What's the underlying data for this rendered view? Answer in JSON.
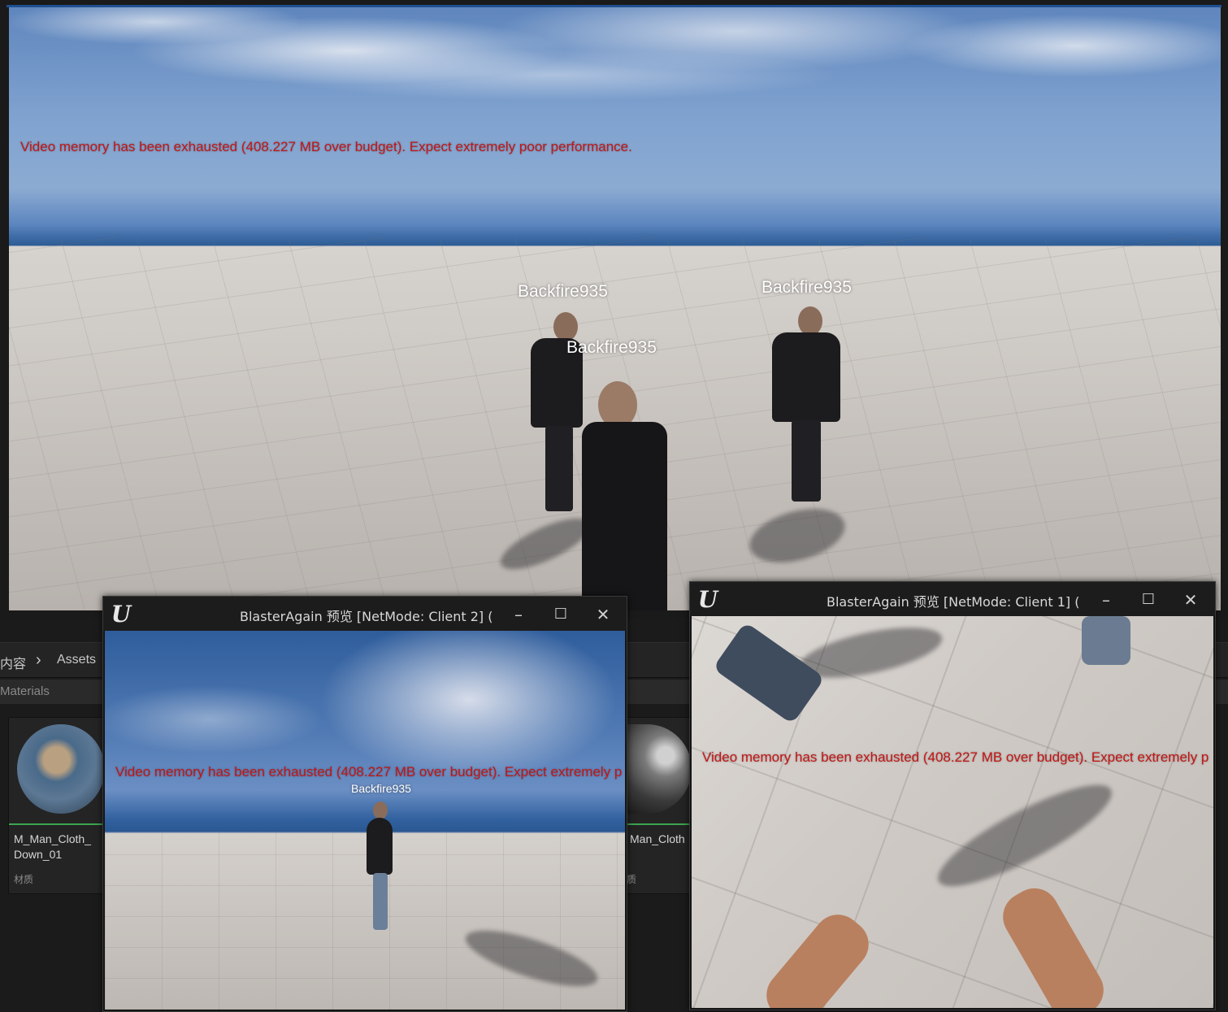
{
  "main_viewport": {
    "warning": "Video memory has been exhausted (408.227 MB over budget). Expect extremely poor performance.",
    "nameplates": [
      "Backfire935",
      "Backfire935",
      "Backfire935"
    ]
  },
  "content_browser": {
    "breadcrumb": [
      "内容",
      "Assets"
    ],
    "breadcrumb_sep": "›",
    "path_label": "Materials",
    "assets": [
      {
        "name_line1": "M_Man_Cloth_",
        "name_line2": "Down_01",
        "type": "材质"
      },
      {
        "name_line1": "Man_Cloth",
        "name_line2": "",
        "type": "质"
      }
    ]
  },
  "pie_client2": {
    "title": "BlasterAgain 预览 [NetMode: Client 2]  (",
    "warning": "Video memory has been exhausted (408.227 MB over budget). Expect extremely p",
    "nameplate": "Backfire935",
    "minimize": "–",
    "maximize": "☐",
    "close": "✕"
  },
  "pie_client1": {
    "title": "BlasterAgain 预览 [NetMode: Client 1]  (",
    "warning": "Video memory has been exhausted (408.227 MB over budget). Expect extremely p",
    "minimize": "–",
    "maximize": "☐",
    "close": "✕"
  },
  "colors": {
    "warning": "#c41616",
    "accent_line": "#1f4f8f",
    "asset_underline": "#3da44f"
  },
  "icons": {
    "app_logo": "unreal-logo-icon"
  }
}
